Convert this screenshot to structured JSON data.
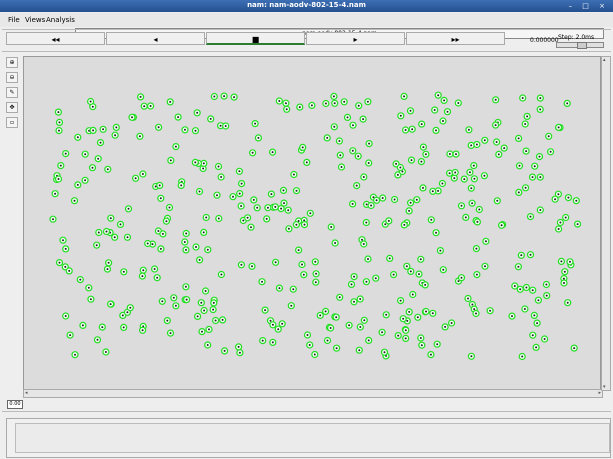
{
  "window": {
    "title": "nam: nam-aodv-802-15-4.nam",
    "controls": "– □ ×"
  },
  "menu": {
    "file": "File",
    "views": "Views",
    "analysis": "Analysis"
  },
  "file_name": "nam-aodv-802-15-4.nam",
  "controls": {
    "rewind": "◂◂",
    "back": "◂",
    "stop": "■",
    "play": "▸",
    "fast_forward": "▸▸"
  },
  "time_value": "0.000000",
  "step_label": "Step: 2.0ms",
  "tools": [
    "zoom-in",
    "zoom-out",
    "edit",
    "pan",
    "select"
  ],
  "small_button": "0.00",
  "colors": {
    "node": "#22dd22",
    "canvas": "#dcdcdc"
  }
}
